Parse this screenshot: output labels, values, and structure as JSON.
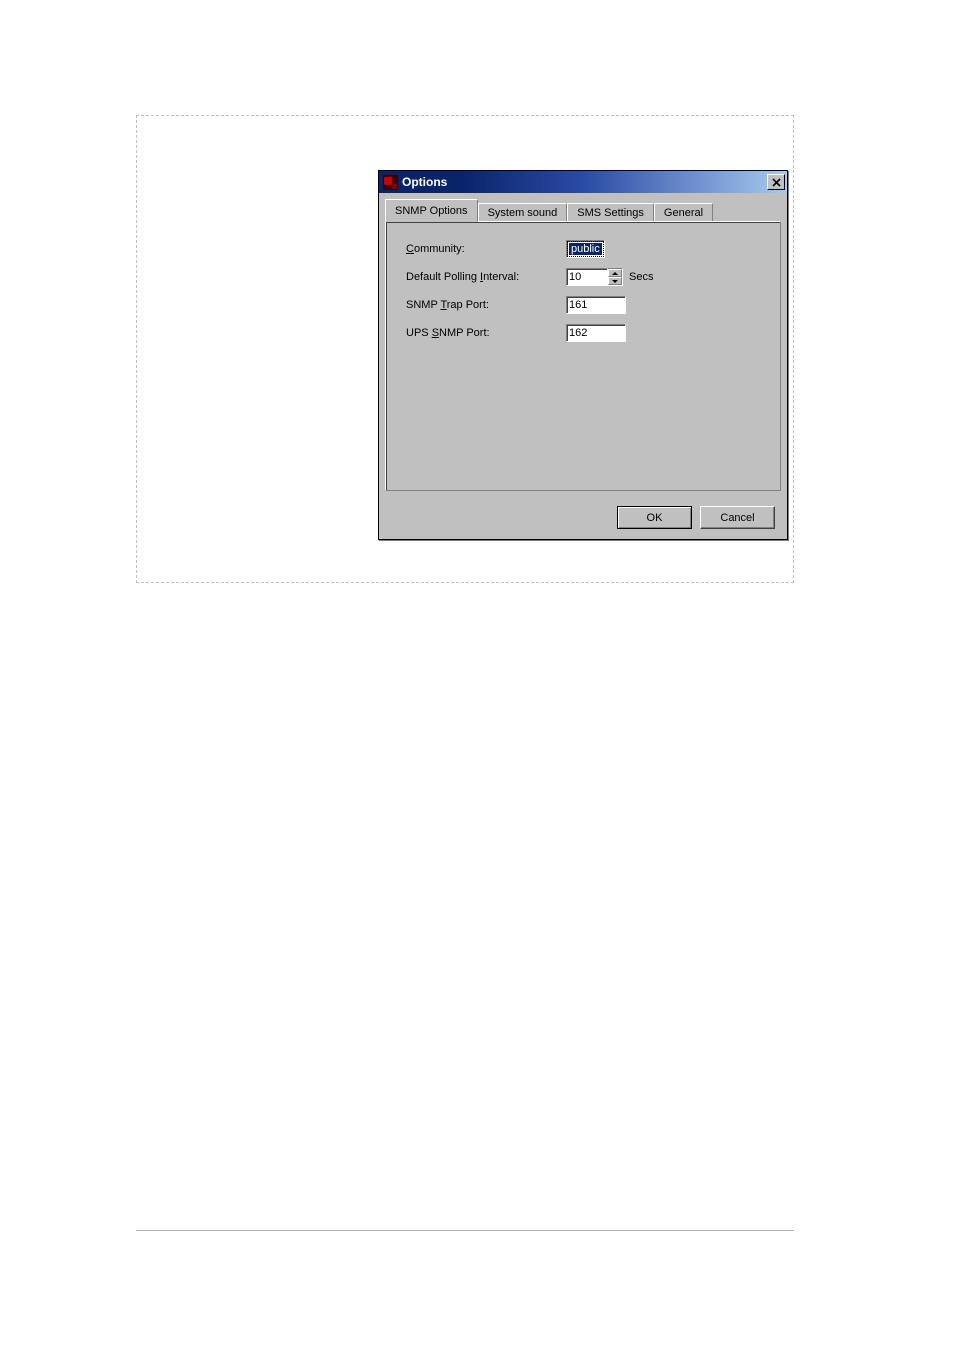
{
  "dialog": {
    "title": "Options",
    "tabs": [
      {
        "label": "SNMP Options",
        "active": true
      },
      {
        "label": "System sound",
        "active": false
      },
      {
        "label": "SMS Settings",
        "active": false
      },
      {
        "label": "General",
        "active": false
      }
    ],
    "fields": {
      "community": {
        "label_pre": "",
        "label_mn": "C",
        "label_post": "ommunity:",
        "value": "public"
      },
      "polling": {
        "label_pre": "Default Polling ",
        "label_mn": "I",
        "label_post": "nterval:",
        "value": "10",
        "unit": "Secs"
      },
      "trapport": {
        "label_pre": "SNMP ",
        "label_mn": "T",
        "label_post": "rap Port:",
        "value": "161"
      },
      "upsport": {
        "label_pre": "UPS ",
        "label_mn": "S",
        "label_post": "NMP Port:",
        "value": "162"
      }
    },
    "buttons": {
      "ok": "OK",
      "cancel": "Cancel"
    }
  }
}
